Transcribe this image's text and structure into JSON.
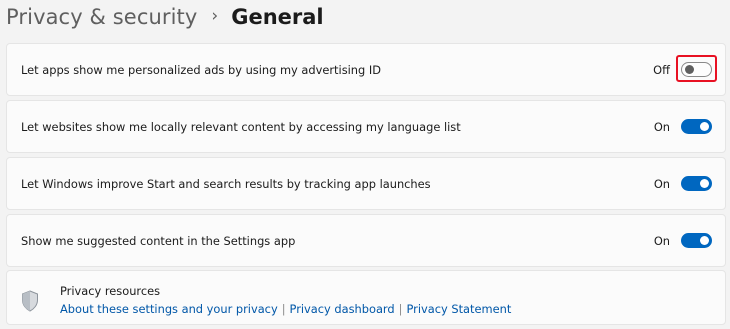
{
  "breadcrumb": {
    "parent": "Privacy & security",
    "separator": "›",
    "current": "General"
  },
  "settings": [
    {
      "label": "Let apps show me personalized ads by using my advertising ID",
      "state": "Off",
      "on": false,
      "highlighted": true
    },
    {
      "label": "Let websites show me locally relevant content by accessing my language list",
      "state": "On",
      "on": true
    },
    {
      "label": "Let Windows improve Start and search results by tracking app launches",
      "state": "On",
      "on": true
    },
    {
      "label": "Show me suggested content in the Settings app",
      "state": "On",
      "on": true
    }
  ],
  "resources": {
    "icon": "shield-icon",
    "title": "Privacy resources",
    "links": [
      "About these settings and your privacy",
      "Privacy dashboard",
      "Privacy Statement"
    ],
    "divider": "|"
  },
  "colors": {
    "accent": "#0067c0",
    "highlight": "#e81123",
    "link": "#0057a8"
  }
}
